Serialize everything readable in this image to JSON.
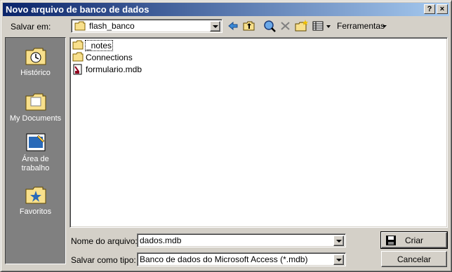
{
  "window": {
    "title": "Novo arquivo de banco de dados",
    "help_btn": "?",
    "close_btn": "×"
  },
  "toolbar": {
    "save_in_label": "Salvar em:",
    "save_in_value": "flash_banco",
    "tools_label": "Ferramentas"
  },
  "places": [
    {
      "label": "Histórico"
    },
    {
      "label": "My Documents"
    },
    {
      "label": "Área de trabalho"
    },
    {
      "label": "Favoritos"
    }
  ],
  "files": [
    {
      "name": "_notes",
      "type": "folder"
    },
    {
      "name": "Connections",
      "type": "folder"
    },
    {
      "name": "formulario.mdb",
      "type": "mdb"
    }
  ],
  "form": {
    "filename_label": "Nome do arquivo:",
    "filename_value": "dados.mdb",
    "filetype_label": "Salvar como tipo:",
    "filetype_value": "Banco de dados do Microsoft Access (*.mdb)"
  },
  "buttons": {
    "create": "Criar",
    "cancel": "Cancelar"
  },
  "colors": {
    "title_start": "#0a246a",
    "title_end": "#a6caf0",
    "face": "#d4d0c8",
    "places_bg": "#808080"
  }
}
